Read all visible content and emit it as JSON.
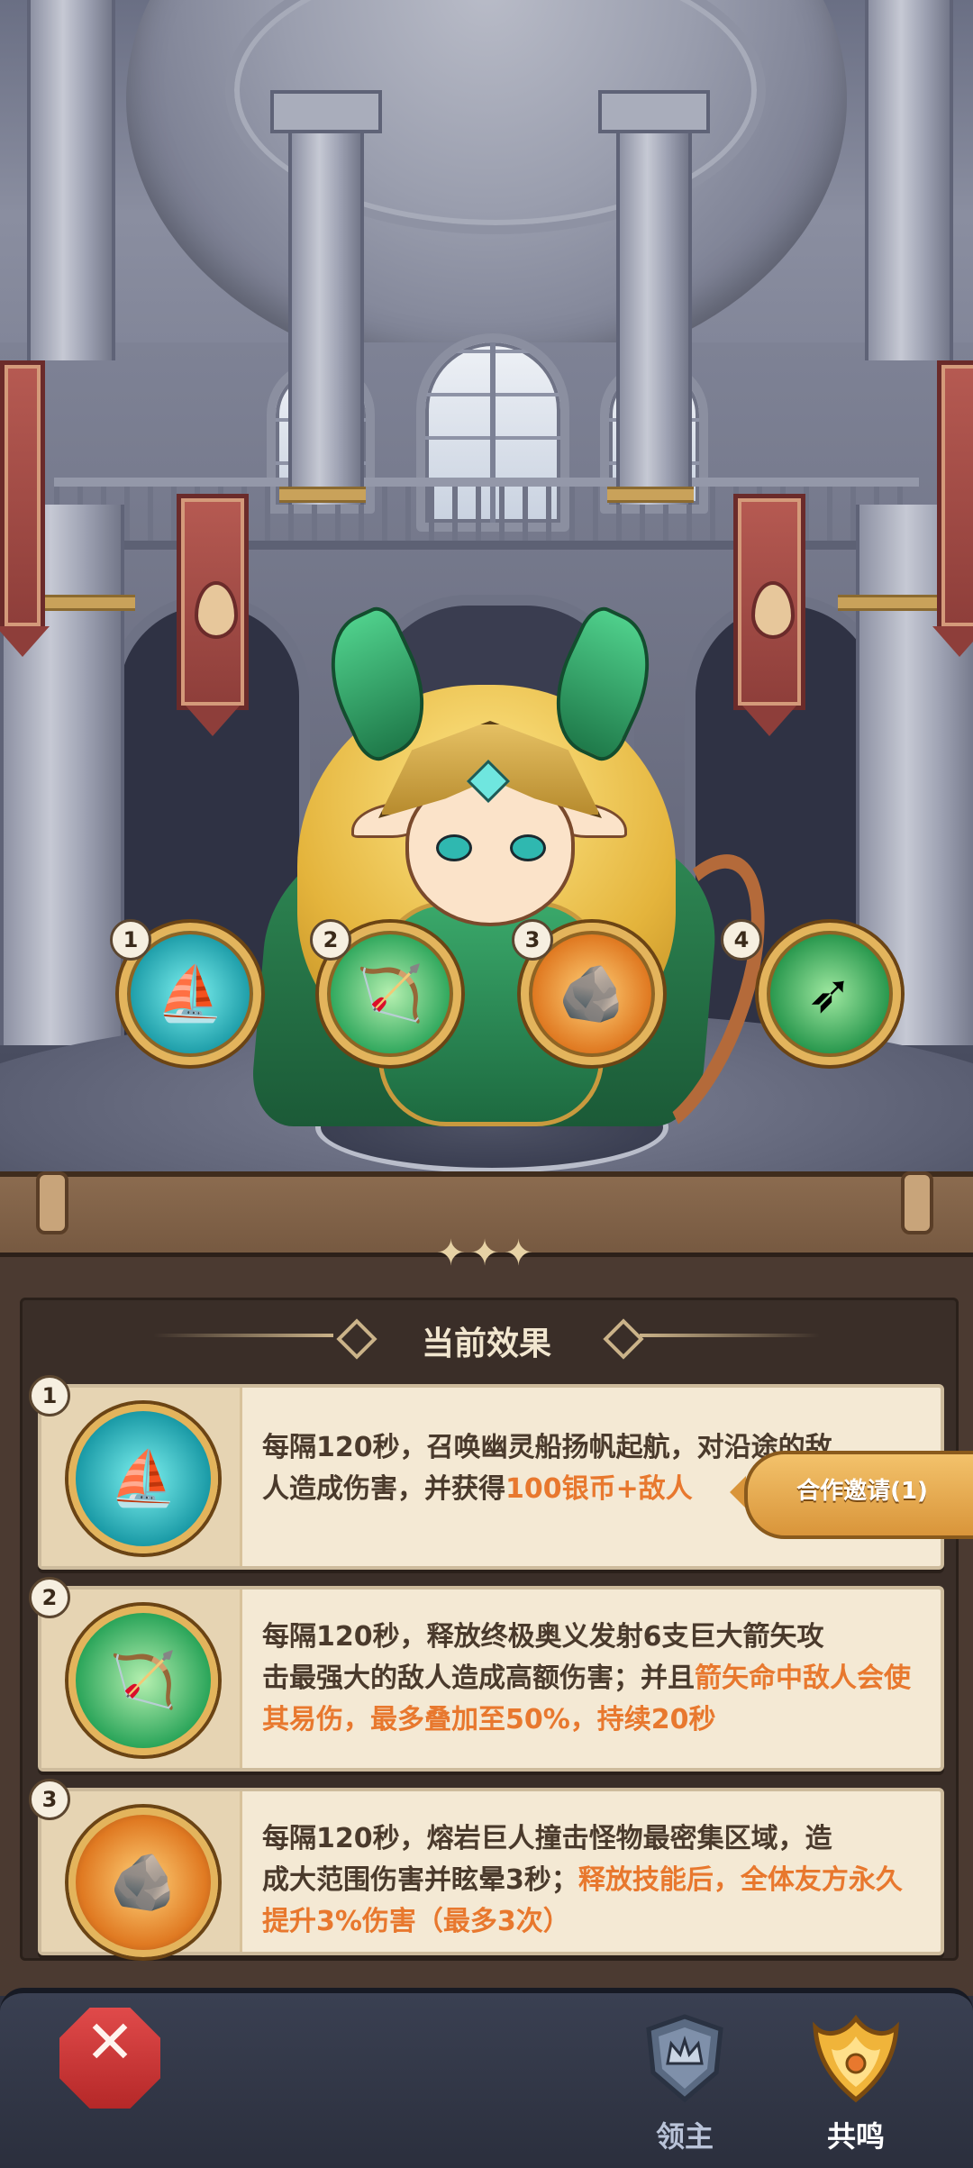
{
  "section_title": "当前效果",
  "coop_button": "合作邀请(1)",
  "skills": [
    {
      "num": "1",
      "icon": "ghost-ship-icon",
      "color": "#1fb5c0"
    },
    {
      "num": "2",
      "icon": "elf-archer-icon",
      "color": "#2ba55a"
    },
    {
      "num": "3",
      "icon": "lava-giant-icon",
      "color": "#e07a22"
    },
    {
      "num": "4",
      "icon": "green-arrow-icon",
      "color": "#2c9a50"
    }
  ],
  "effects": [
    {
      "num": "1",
      "icon": "ghost-ship-icon",
      "text_a": "每隔120秒，召唤幽灵船扬帆起航，对沿途的敌",
      "text_b": "人造成伤害，并获得",
      "text_hl": "100银币+敌人"
    },
    {
      "num": "2",
      "icon": "elf-archer-icon",
      "text_a": "每隔120秒，释放终极奥义发射6支巨大箭矢攻",
      "text_b": "击最强大的敌人造成高额伤害；并且",
      "text_hl": "箭矢命中敌人会使其易伤，最多叠加至50%，持续20秒"
    },
    {
      "num": "3",
      "icon": "lava-giant-icon",
      "text_a": "每隔120秒，熔岩巨人撞击怪物最密集区域，造",
      "text_b": "成大范围伤害并眩晕3秒；",
      "text_hl": "释放技能后，全体友方永久提升3%伤害（最多3次）"
    }
  ],
  "nav": {
    "lord_label": "领主",
    "resonance_label": "共鸣"
  },
  "colors": {
    "highlight": "#e8782e",
    "gold_frame": "#e3b45c",
    "close_red": "#c93636"
  }
}
